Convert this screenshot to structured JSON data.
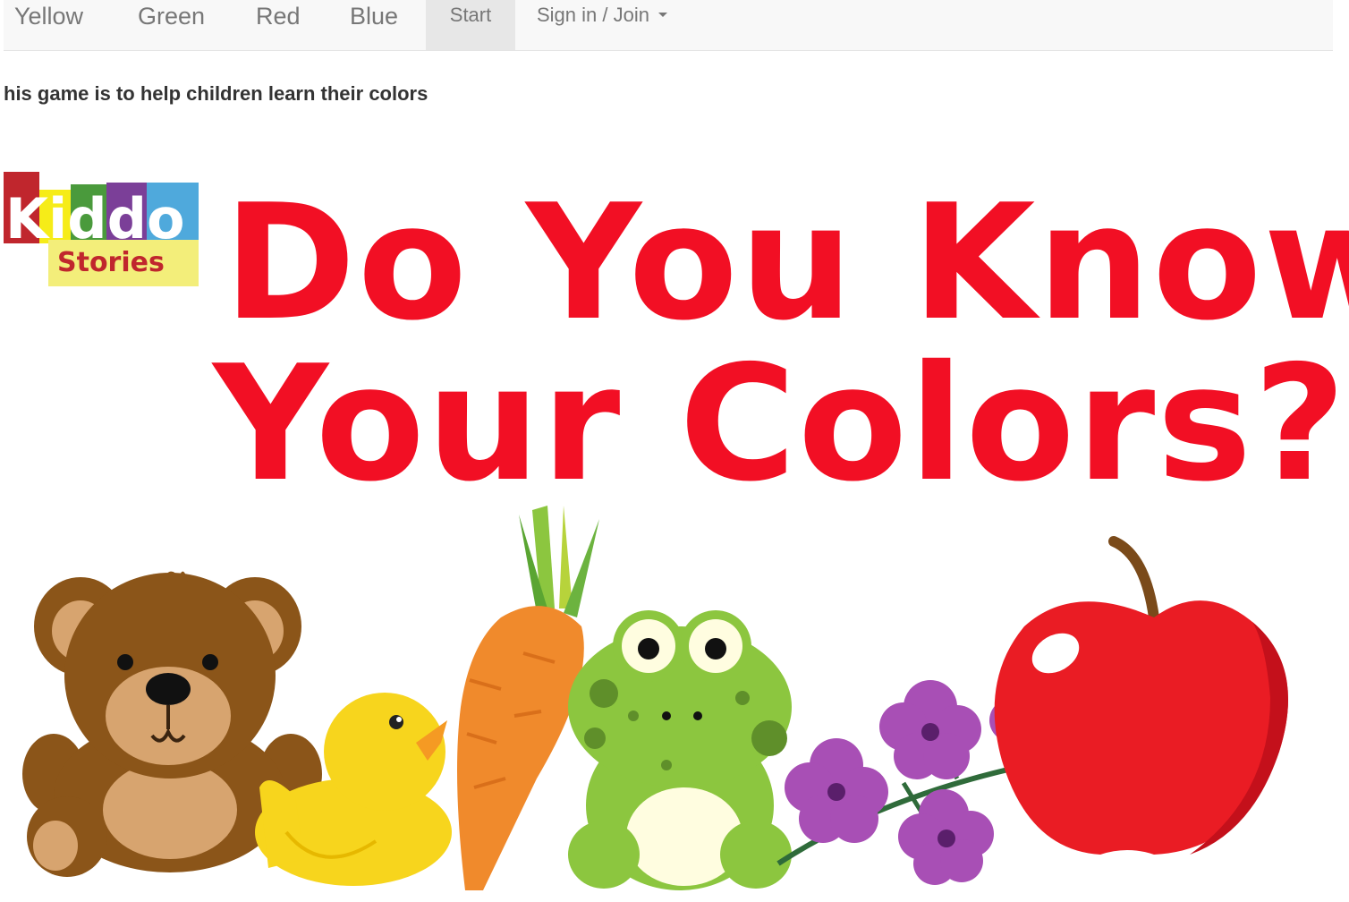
{
  "nav": {
    "items": [
      {
        "label": "Yellow"
      },
      {
        "label": "Green"
      },
      {
        "label": "Red"
      },
      {
        "label": "Blue"
      },
      {
        "label": "Start"
      },
      {
        "label": "Sign in / Join"
      }
    ],
    "active": "Start"
  },
  "intro_text": "his game is to help children learn their colors",
  "hero": {
    "logo_top": "Kiddo",
    "logo_bottom": "Stories",
    "headline_line1": "Do You Know",
    "headline_line2": "Your Colors?",
    "illustrations": [
      "teddy-bear-icon",
      "rubber-duck-icon",
      "carrot-icon",
      "frog-icon",
      "purple-flowers-icon",
      "apple-icon"
    ]
  },
  "colors": {
    "headline": "#f20f24",
    "nav_bg": "#f8f8f8",
    "nav_active": "#e7e7e7",
    "nav_text": "#777777"
  }
}
